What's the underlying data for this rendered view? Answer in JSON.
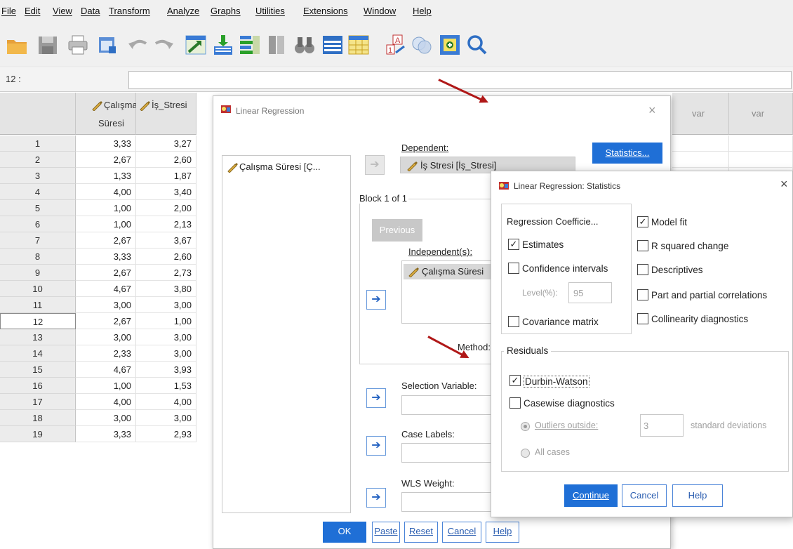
{
  "menu": [
    "File",
    "Edit",
    "View",
    "Data",
    "Transform",
    "Analyze",
    "Graphs",
    "Utilities",
    "Extensions",
    "Window",
    "Help"
  ],
  "cellbar": {
    "ref": "12 :",
    "value": ""
  },
  "columns": {
    "col1": {
      "line1": "Çalışma_",
      "line2": "Süresi"
    },
    "col2": "İş_Stresi",
    "var1": "var",
    "var2": "var"
  },
  "rows": [
    {
      "n": "1",
      "a": "3,33",
      "b": "3,27"
    },
    {
      "n": "2",
      "a": "2,67",
      "b": "2,60"
    },
    {
      "n": "3",
      "a": "1,33",
      "b": "1,87"
    },
    {
      "n": "4",
      "a": "4,00",
      "b": "3,40"
    },
    {
      "n": "5",
      "a": "1,00",
      "b": "2,00"
    },
    {
      "n": "6",
      "a": "1,00",
      "b": "2,13"
    },
    {
      "n": "7",
      "a": "2,67",
      "b": "3,67"
    },
    {
      "n": "8",
      "a": "3,33",
      "b": "2,60"
    },
    {
      "n": "9",
      "a": "2,67",
      "b": "2,73"
    },
    {
      "n": "10",
      "a": "4,67",
      "b": "3,80"
    },
    {
      "n": "11",
      "a": "3,00",
      "b": "3,00"
    },
    {
      "n": "12",
      "a": "2,67",
      "b": "1,00"
    },
    {
      "n": "13",
      "a": "3,00",
      "b": "3,00"
    },
    {
      "n": "14",
      "a": "2,33",
      "b": "3,00"
    },
    {
      "n": "15",
      "a": "4,67",
      "b": "3,93"
    },
    {
      "n": "16",
      "a": "1,00",
      "b": "1,53"
    },
    {
      "n": "17",
      "a": "4,00",
      "b": "4,00"
    },
    {
      "n": "18",
      "a": "3,00",
      "b": "3,00"
    },
    {
      "n": "19",
      "a": "3,33",
      "b": "2,93"
    }
  ],
  "selected_row": "12",
  "linear_regression": {
    "title": "Linear Regression",
    "close": "×",
    "source_var": "Çalışma Süresi [Ç...",
    "dependent_label": "Dependent:",
    "dependent_value": "İş Stresi [İş_Stresi]",
    "block_label": "Block 1 of 1",
    "previous": "Previous",
    "independent_label": "Independent(s):",
    "independent_value": "Çalışma Süresi",
    "method_label": "Method:",
    "selection_label": "Selection Variable:",
    "case_labels_label": "Case Labels:",
    "wls_label": "WLS Weight:",
    "statistics_btn": "Statistics...",
    "ok": "OK",
    "paste": "Paste",
    "reset": "Reset",
    "cancel": "Cancel",
    "help": "Help"
  },
  "stats_dialog": {
    "title": "Linear Regression: Statistics",
    "close": "×",
    "coef_group": "Regression Coefficie...",
    "estimates": "Estimates",
    "confidence": "Confidence intervals",
    "level_label": "Level(%):",
    "level_value": "95",
    "covariance": "Covariance matrix",
    "model_fit": "Model fit",
    "r_squared": "R squared change",
    "descriptives": "Descriptives",
    "part_partial": "Part and partial correlations",
    "collinearity": "Collinearity diagnostics",
    "residuals_group": "Residuals",
    "durbin": "Durbin-Watson",
    "casewise": "Casewise diagnostics",
    "outliers": "Outliers outside:",
    "outliers_value": "3",
    "std_dev": "standard deviations",
    "all_cases": "All cases",
    "continue": "Continue",
    "cancel": "Cancel",
    "help": "Help"
  },
  "checkbox_states": {
    "estimates": true,
    "confidence": false,
    "covariance": false,
    "model_fit": true,
    "r_squared": false,
    "descriptives": false,
    "part_partial": false,
    "collinearity": false,
    "durbin": true,
    "casewise": false
  },
  "colors": {
    "accent": "#1f6fd6",
    "annotation_arrow": "#b01818",
    "header_gray": "#e4e4e4"
  }
}
